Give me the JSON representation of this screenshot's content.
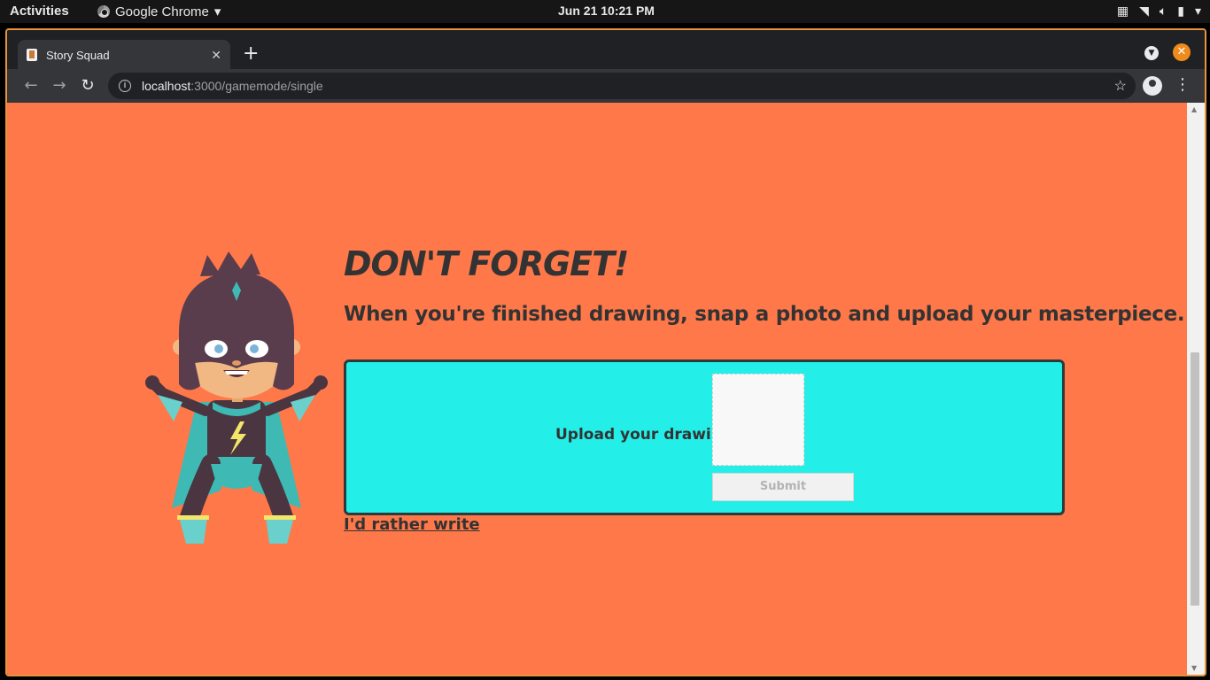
{
  "system": {
    "activities_label": "Activities",
    "app_name": "Google Chrome",
    "clock": "Jun 21  10:21 PM"
  },
  "browser": {
    "tab_title": "Story Squad",
    "url_host": "localhost",
    "url_path": ":3000/gamemode/single"
  },
  "page": {
    "heading": "DON'T FORGET!",
    "subheading": "When you're finished drawing, snap a photo and upload your masterpiece.",
    "upload_label": "Upload your drawing",
    "submit_label": "Submit",
    "alt_link": "I'd rather write",
    "colors": {
      "background": "#ff7849",
      "upload_box": "#23eee8",
      "text": "#333333"
    }
  }
}
